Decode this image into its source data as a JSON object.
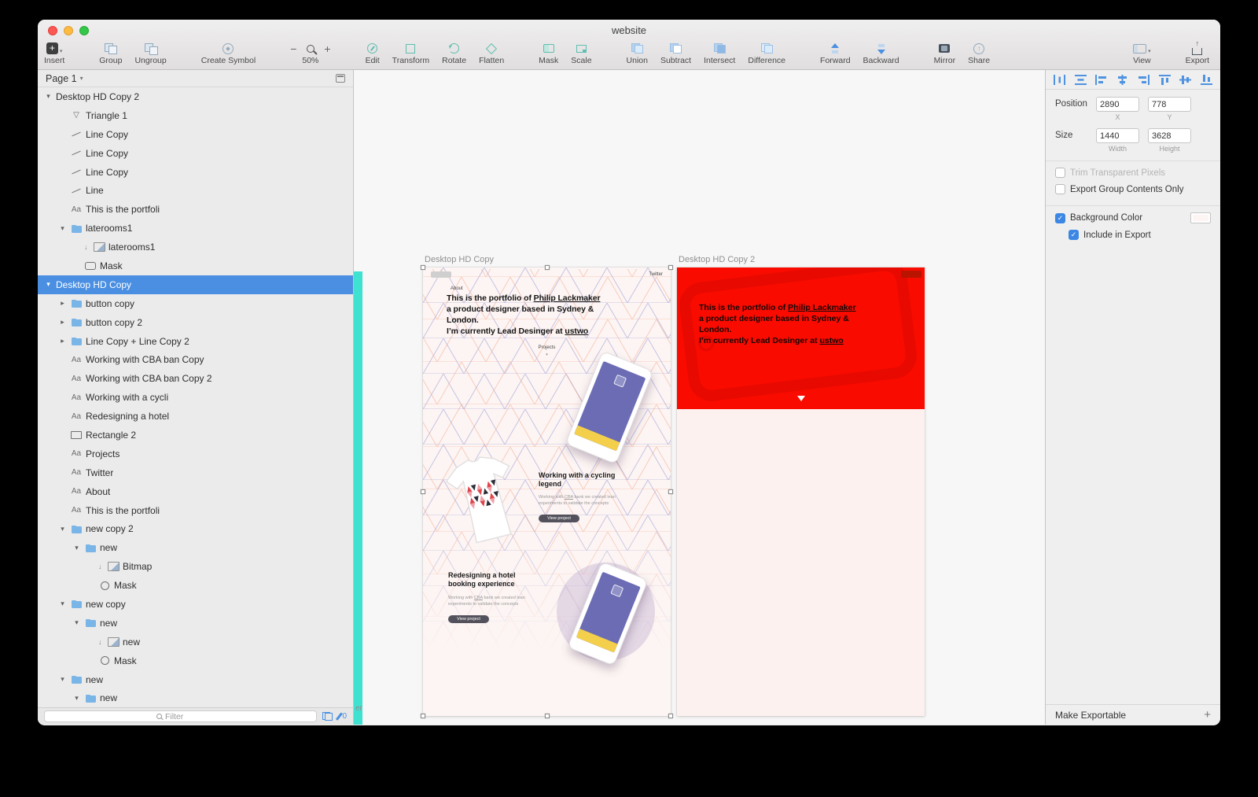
{
  "window": {
    "title": "website"
  },
  "colors": {
    "accent_blue": "#4a90e2",
    "selection_blue": "#4a8fe2",
    "artboard_red": "#f90b00",
    "artboard_pink": "#fcf1ee",
    "teal_artboard_edge": "#3fe2d1"
  },
  "toolbar": {
    "groups": [
      {
        "items": [
          {
            "icon": "insert-icon",
            "label": "Insert",
            "caret": true
          }
        ]
      },
      {
        "items": [
          {
            "icon": "group-icon",
            "label": "Group"
          },
          {
            "icon": "ungroup-icon",
            "label": "Ungroup"
          }
        ]
      },
      {
        "items": [
          {
            "icon": "create-symbol-icon",
            "label": "Create Symbol"
          }
        ]
      },
      {
        "zoom": true,
        "minus": "−",
        "plus": "+",
        "label": "50%"
      },
      {
        "items": [
          {
            "icon": "edit-icon",
            "label": "Edit"
          },
          {
            "icon": "transform-icon",
            "label": "Transform"
          },
          {
            "icon": "rotate-icon",
            "label": "Rotate"
          },
          {
            "icon": "flatten-icon",
            "label": "Flatten"
          }
        ]
      },
      {
        "items": [
          {
            "icon": "mask-icon",
            "label": "Mask"
          },
          {
            "icon": "scale-icon",
            "label": "Scale"
          }
        ]
      },
      {
        "items": [
          {
            "icon": "union-icon",
            "label": "Union"
          },
          {
            "icon": "subtract-icon",
            "label": "Subtract"
          },
          {
            "icon": "intersect-icon",
            "label": "Intersect"
          },
          {
            "icon": "difference-icon",
            "label": "Difference"
          }
        ]
      },
      {
        "items": [
          {
            "icon": "forward-icon",
            "label": "Forward"
          },
          {
            "icon": "backward-icon",
            "label": "Backward"
          }
        ]
      },
      {
        "items": [
          {
            "icon": "mirror-icon",
            "label": "Mirror"
          },
          {
            "icon": "share-icon",
            "label": "Share"
          }
        ]
      },
      {
        "view_group": true,
        "items": [
          {
            "icon": "view-icon",
            "label": "View",
            "caret": true
          }
        ]
      },
      {
        "export_group": true,
        "items": [
          {
            "icon": "export-icon",
            "label": "Export"
          }
        ]
      }
    ]
  },
  "layers": {
    "page_selector": "Page 1",
    "filter_placeholder": "Filter",
    "edit_count": "0",
    "items": [
      {
        "label": "Desktop HD Copy 2",
        "depth": 0,
        "disclosure": "open"
      },
      {
        "label": "Triangle 1",
        "depth": 1,
        "icon": "triangle"
      },
      {
        "label": "Line Copy",
        "depth": 1,
        "icon": "line"
      },
      {
        "label": "Line Copy",
        "depth": 1,
        "icon": "line"
      },
      {
        "label": "Line Copy",
        "depth": 1,
        "icon": "line"
      },
      {
        "label": "Line",
        "depth": 1,
        "icon": "line"
      },
      {
        "label": "This is the portfoli",
        "depth": 1,
        "icon": "text"
      },
      {
        "label": "laterooms1",
        "depth": 1,
        "icon": "folder",
        "disclosure": "open"
      },
      {
        "label": "laterooms1",
        "depth": 2,
        "icon": "image",
        "prefix": true
      },
      {
        "label": "Mask",
        "depth": 2,
        "icon": "mask-rect"
      },
      {
        "label": "Desktop HD Copy",
        "depth": 0,
        "disclosure": "open",
        "selected": true
      },
      {
        "label": "button copy",
        "depth": 1,
        "icon": "folder",
        "disclosure": "closed"
      },
      {
        "label": "button copy 2",
        "depth": 1,
        "icon": "folder",
        "disclosure": "closed"
      },
      {
        "label": "Line Copy + Line Copy 2",
        "depth": 1,
        "icon": "folder",
        "disclosure": "closed"
      },
      {
        "label": "Working with CBA ban Copy",
        "depth": 1,
        "icon": "text"
      },
      {
        "label": "Working with CBA ban Copy 2",
        "depth": 1,
        "icon": "text"
      },
      {
        "label": "Working with a cycli",
        "depth": 1,
        "icon": "text"
      },
      {
        "label": "Redesigning a hotel",
        "depth": 1,
        "icon": "text"
      },
      {
        "label": "Rectangle 2",
        "depth": 1,
        "icon": "rect"
      },
      {
        "label": "Projects",
        "depth": 1,
        "icon": "text"
      },
      {
        "label": "Twitter",
        "depth": 1,
        "icon": "text"
      },
      {
        "label": "About",
        "depth": 1,
        "icon": "text"
      },
      {
        "label": "This is the portfoli",
        "depth": 1,
        "icon": "text"
      },
      {
        "label": "new copy 2",
        "depth": 1,
        "icon": "folder",
        "disclosure": "open"
      },
      {
        "label": "new",
        "depth": 2,
        "icon": "folder",
        "disclosure": "open"
      },
      {
        "label": "Bitmap",
        "depth": 3,
        "icon": "image",
        "prefix": true
      },
      {
        "label": "Mask",
        "depth": 3,
        "icon": "circle"
      },
      {
        "label": "new copy",
        "depth": 1,
        "icon": "folder",
        "disclosure": "open"
      },
      {
        "label": "new",
        "depth": 2,
        "icon": "folder",
        "disclosure": "open"
      },
      {
        "label": "new",
        "depth": 3,
        "icon": "image",
        "prefix": true
      },
      {
        "label": "Mask",
        "depth": 3,
        "icon": "circle"
      },
      {
        "label": "new",
        "depth": 1,
        "icon": "folder",
        "disclosure": "open"
      },
      {
        "label": "new",
        "depth": 2,
        "icon": "folder",
        "disclosure": "open"
      }
    ]
  },
  "canvas": {
    "edge_label": "er",
    "heading": {
      "line1_pre": "This is the portfolio of ",
      "line1_link": "Philip Lackmaker",
      "line2a": "a product designer based in Sydney &",
      "line2b": "London.",
      "line3_pre": "I’m currently Lead Desinger at ",
      "line3_link": "ustwo"
    },
    "artboard1": {
      "name": "Desktop HD Copy",
      "about": "About",
      "twitter": "Twitter",
      "projects": "Projects",
      "project1": {
        "title": "Working with a cycling legend",
        "desc_pre": "Working with ",
        "desc_link": "CBA",
        "desc_post": " bank we created lean experiments to validate the concepts",
        "button": "View project"
      },
      "project2": {
        "title": "Redesigning a hotel booking experience",
        "desc_pre": "Working with ",
        "desc_link": "CBA",
        "desc_post": " bank we created lean experiments to validate the concepts",
        "button": "View project"
      }
    },
    "artboard2": {
      "name": "Desktop HD Copy 2"
    }
  },
  "inspector": {
    "position": {
      "label": "Position",
      "x": "2890",
      "y": "778",
      "x_sub": "X",
      "y_sub": "Y"
    },
    "size": {
      "label": "Size",
      "width": "1440",
      "height": "3628",
      "w_sub": "Width",
      "h_sub": "Height"
    },
    "options": [
      {
        "label": "Trim Transparent Pixels",
        "checked": false,
        "disabled": true
      },
      {
        "label": "Export Group Contents Only",
        "checked": false
      },
      {
        "label": "Background Color",
        "checked": true,
        "swatch": "#fdf5f3",
        "divider_before": true
      },
      {
        "label": "Include in Export",
        "checked": true,
        "indent": true
      }
    ],
    "make_exportable": "Make Exportable",
    "add_symbol": "+"
  }
}
